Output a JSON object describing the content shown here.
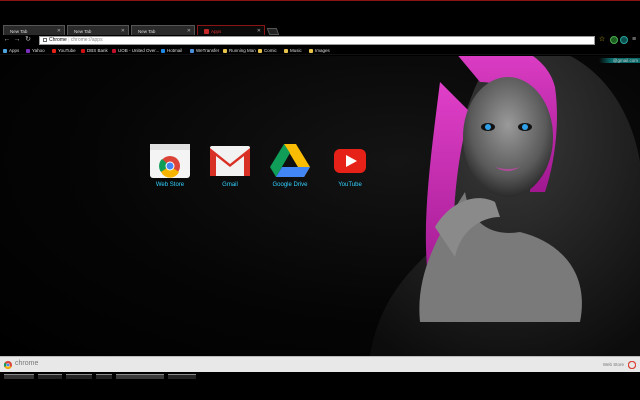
{
  "tabs": [
    {
      "title": "New Tab"
    },
    {
      "title": "New Tab"
    },
    {
      "title": "New Tab"
    },
    {
      "title": "Apps"
    }
  ],
  "omnibox": {
    "scheme_label": "Chrome",
    "path": "chrome://apps"
  },
  "bookmarks": [
    {
      "label": "Apps",
      "icon": "apps-grid-icon",
      "color": "#4fa3e0"
    },
    {
      "label": "Yahoo",
      "icon": "yahoo-icon",
      "color": "#7b2fbf"
    },
    {
      "label": "YouTube",
      "icon": "youtube-icon",
      "color": "#e62117"
    },
    {
      "label": "DBS Bank",
      "icon": "dbs-icon",
      "color": "#d01010"
    },
    {
      "label": "UOB - United Over...",
      "icon": "uob-icon",
      "color": "#c0102a"
    },
    {
      "label": "Hotmail",
      "icon": "hotmail-icon",
      "color": "#1e88e5"
    },
    {
      "label": "WeTransfer",
      "icon": "wetransfer-icon",
      "color": "#4a90d9"
    },
    {
      "label": "Running Man",
      "icon": "folder-icon",
      "color": "#e8c44c"
    },
    {
      "label": "Comic",
      "icon": "folder-icon",
      "color": "#e8c44c"
    },
    {
      "label": "Music",
      "icon": "folder-icon",
      "color": "#e8c44c"
    },
    {
      "label": "Images",
      "icon": "folder-icon",
      "color": "#e8c44c"
    }
  ],
  "user_email": "@gmail.com",
  "apps": [
    {
      "label": "Web Store",
      "icon": "web-store-icon"
    },
    {
      "label": "Gmail",
      "icon": "gmail-icon"
    },
    {
      "label": "Google Drive",
      "icon": "google-drive-icon"
    },
    {
      "label": "YouTube",
      "icon": "youtube-icon"
    }
  ],
  "bottom_bar": {
    "brand": "chrome",
    "web_store_link": "Web Store"
  },
  "colors": {
    "accent_red": "#c62828",
    "app_label": "#33d1ff",
    "tab_border": "#8a1414"
  }
}
